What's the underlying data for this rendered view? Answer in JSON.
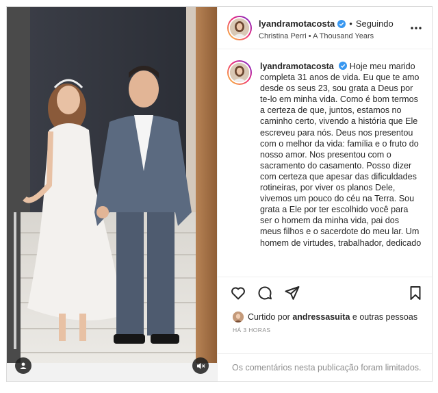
{
  "post": {
    "author": {
      "username": "lyandramotacosta",
      "verified": true,
      "follow_state": "Seguindo",
      "separator": "•"
    },
    "audio": {
      "artist": "Christina Perri",
      "separator": "•",
      "track": "A Thousand Years"
    },
    "caption": {
      "username": "lyandramotacosta",
      "text": "Hoje meu marido completa 31 anos de vida. Eu que te amo desde os seus 23, sou grata a Deus por te-lo em minha vida. Como é bom termos a certeza de que, juntos, estamos no caminho certo, vivendo a história que Ele escreveu para nós. Deus nos presentou com o melhor da vida: família e o fruto do nosso amor. Nos presentou com o sacramento do casamento. Posso dizer com certeza que apesar das dificuldades rotineiras, por viver os planos Dele, vivemos um pouco do céu na Terra. Sou grata a Ele por ter escolhido você para ser o homem da minha vida, pai dos meus filhos e o sacerdote do meu lar. Um homem de virtudes, trabalhador, dedicado"
    },
    "likes": {
      "prefix": "Curtido por",
      "liker": "andressasuita",
      "suffix": "e outras pessoas"
    },
    "timestamp": "HÁ 3 HORAS",
    "comments_notice": "Os comentários nesta publicação foram limitados."
  },
  "icons": {
    "header_more": "more-horizontal-icon",
    "verified": "verified-badge-icon",
    "like": "heart-icon",
    "comment": "comment-bubble-icon",
    "share": "paper-plane-icon",
    "save": "bookmark-icon",
    "tag": "user-tag-icon",
    "mute": "speaker-muted-icon"
  },
  "colors": {
    "verified_blue": "#3897f0",
    "text_primary": "#262626",
    "text_secondary": "#8e8e8e",
    "divider": "#efefef"
  }
}
